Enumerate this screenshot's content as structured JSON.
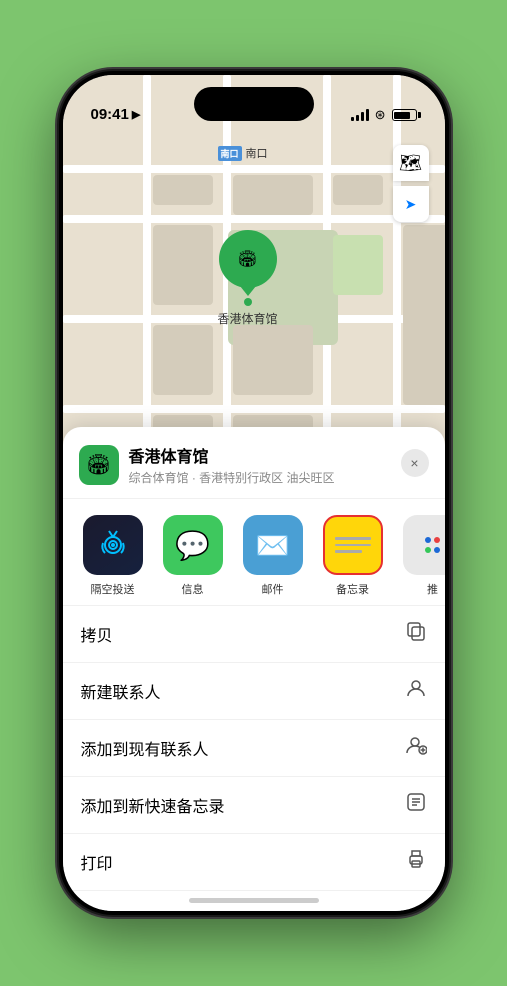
{
  "status": {
    "time": "09:41",
    "location_arrow": "▶",
    "signal_bars": [
      4,
      6,
      8,
      10
    ],
    "wifi": "wifi",
    "battery": 80
  },
  "map": {
    "south_gate_badge": "南口",
    "stadium_label": "香港体育馆"
  },
  "map_controls": {
    "map_icon": "🗺",
    "location_icon": "➤"
  },
  "venue": {
    "name": "香港体育馆",
    "subtitle": "综合体育馆 · 香港特别行政区 油尖旺区",
    "close_label": "×"
  },
  "share_actions": [
    {
      "id": "airdrop",
      "label": "隔空投送",
      "type": "airdrop"
    },
    {
      "id": "message",
      "label": "信息",
      "type": "message"
    },
    {
      "id": "mail",
      "label": "邮件",
      "type": "mail"
    },
    {
      "id": "notes",
      "label": "备忘录",
      "type": "notes"
    },
    {
      "id": "more",
      "label": "推",
      "type": "more"
    }
  ],
  "menu_items": [
    {
      "label": "拷贝",
      "icon": "copy"
    },
    {
      "label": "新建联系人",
      "icon": "person"
    },
    {
      "label": "添加到现有联系人",
      "icon": "person_add"
    },
    {
      "label": "添加到新快速备忘录",
      "icon": "note"
    },
    {
      "label": "打印",
      "icon": "print"
    }
  ]
}
